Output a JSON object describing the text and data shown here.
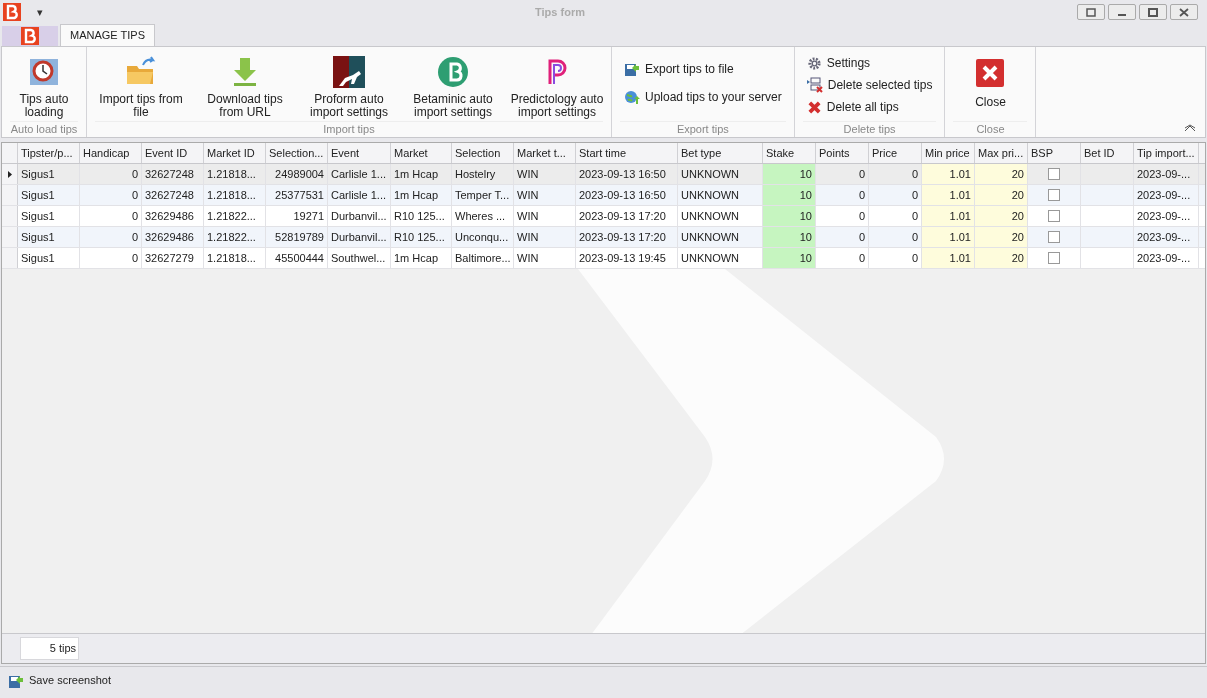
{
  "window": {
    "title": "Tips form",
    "quick_access": "▾"
  },
  "ribbon_tabs": [
    {
      "label": "MANAGE TIPS",
      "selected": true
    }
  ],
  "ribbon_groups": [
    {
      "label": "Auto load tips",
      "items": [
        {
          "kind": "large",
          "label": "Tips auto loading"
        }
      ]
    },
    {
      "label": "Import tips",
      "items": [
        {
          "kind": "large",
          "label": "Import tips from file"
        },
        {
          "kind": "large",
          "label": "Download tips from URL"
        },
        {
          "kind": "large",
          "label": "Proform auto import settings"
        },
        {
          "kind": "large",
          "label": "Betaminic auto import settings"
        },
        {
          "kind": "large",
          "label": "Predictology auto import settings"
        }
      ]
    },
    {
      "label": "Export tips",
      "items": [
        {
          "kind": "small",
          "label": "Export tips to file"
        },
        {
          "kind": "small",
          "label": "Upload tips to your server"
        }
      ]
    },
    {
      "label": "Delete tips",
      "items": [
        {
          "kind": "compact",
          "label": "Settings"
        },
        {
          "kind": "compact",
          "label": "Delete selected tips"
        },
        {
          "kind": "compact",
          "label": "Delete all tips"
        }
      ]
    },
    {
      "label": "Close",
      "items": [
        {
          "kind": "large",
          "label": "Close"
        }
      ]
    }
  ],
  "table": {
    "columns": [
      {
        "label": "Tipster/p...",
        "kind": "text"
      },
      {
        "label": "Handicap",
        "kind": "number"
      },
      {
        "label": "Event ID",
        "kind": "text"
      },
      {
        "label": "Market ID",
        "kind": "text"
      },
      {
        "label": "Selection...",
        "kind": "number"
      },
      {
        "label": "Event",
        "kind": "text"
      },
      {
        "label": "Market",
        "kind": "text"
      },
      {
        "label": "Selection",
        "kind": "text"
      },
      {
        "label": "Market t...",
        "kind": "text"
      },
      {
        "label": "Start time",
        "kind": "text"
      },
      {
        "label": "Bet type",
        "kind": "text"
      },
      {
        "label": "Stake",
        "kind": "stake"
      },
      {
        "label": "Points",
        "kind": "number"
      },
      {
        "label": "Price",
        "kind": "number"
      },
      {
        "label": "Min price",
        "kind": "limit"
      },
      {
        "label": "Max pri...",
        "kind": "limit"
      },
      {
        "label": "BSP",
        "kind": "check"
      },
      {
        "label": "Bet ID",
        "kind": "text"
      },
      {
        "label": "Tip import...",
        "kind": "text"
      }
    ],
    "rows": [
      {
        "selected": true,
        "bsp_checked": false,
        "cells": [
          "Sigus1",
          "0",
          "32627248",
          "1.21818...",
          "24989004",
          "Carlisle 1...",
          "1m Hcap",
          "Hostelry",
          "WIN",
          "2023-09-13 16:50",
          "UNKNOWN",
          "10",
          "0",
          "0",
          "1.01",
          "20",
          null,
          null,
          "2023-09-..."
        ]
      },
      {
        "selected": false,
        "bsp_checked": false,
        "cells": [
          "Sigus1",
          "0",
          "32627248",
          "1.21818...",
          "25377531",
          "Carlisle 1...",
          "1m Hcap",
          "Temper T...",
          "WIN",
          "2023-09-13 16:50",
          "UNKNOWN",
          "10",
          "0",
          "0",
          "1.01",
          "20",
          null,
          null,
          "2023-09-..."
        ]
      },
      {
        "selected": false,
        "bsp_checked": false,
        "cells": [
          "Sigus1",
          "0",
          "32629486",
          "1.21822...",
          "19271",
          "Durbanvil...",
          "R10 125...",
          "Wheres ...",
          "WIN",
          "2023-09-13 17:20",
          "UNKNOWN",
          "10",
          "0",
          "0",
          "1.01",
          "20",
          null,
          null,
          "2023-09-..."
        ]
      },
      {
        "selected": false,
        "bsp_checked": false,
        "cells": [
          "Sigus1",
          "0",
          "32629486",
          "1.21822...",
          "52819789",
          "Durbanvil...",
          "R10 125...",
          "Unconqu...",
          "WIN",
          "2023-09-13 17:20",
          "UNKNOWN",
          "10",
          "0",
          "0",
          "1.01",
          "20",
          null,
          null,
          "2023-09-..."
        ]
      },
      {
        "selected": false,
        "bsp_checked": false,
        "cells": [
          "Sigus1",
          "0",
          "32627279",
          "1.21818...",
          "45500444",
          "Southwel...",
          "1m Hcap",
          "Baltimore...",
          "WIN",
          "2023-09-13 19:45",
          "UNKNOWN",
          "10",
          "0",
          "0",
          "1.01",
          "20",
          null,
          null,
          "2023-09-..."
        ]
      }
    ]
  },
  "footer": {
    "count": "5 tips"
  },
  "status_bar": {
    "action": "Save screenshot"
  }
}
